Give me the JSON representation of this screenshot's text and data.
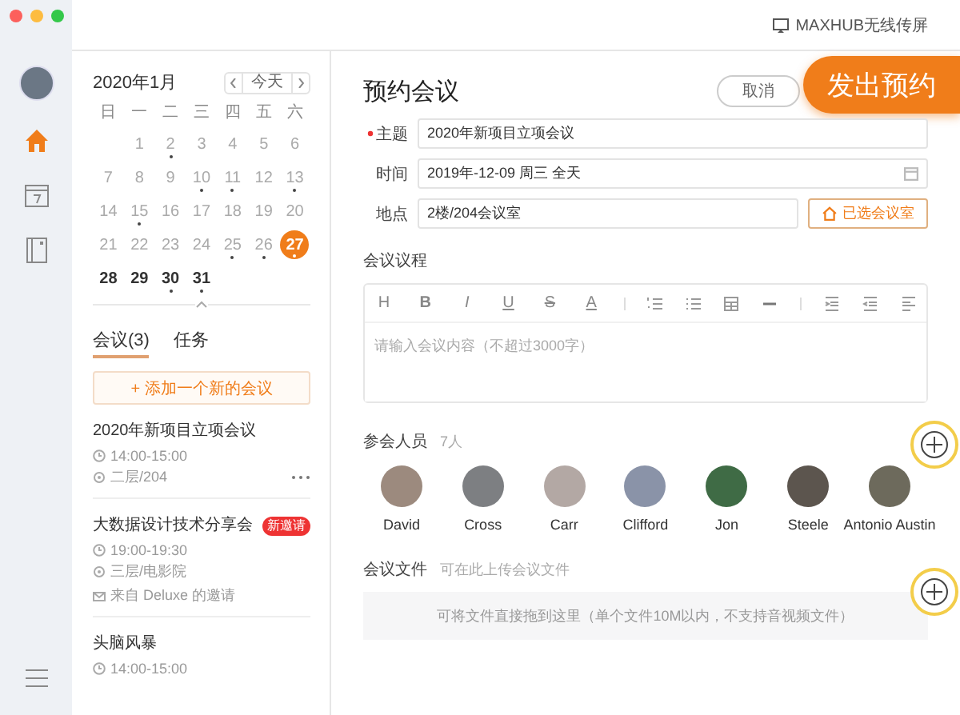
{
  "topbar": {
    "cast_label": "MAXHUB无线传屏"
  },
  "rail": {
    "items": [
      {
        "kind": "avatar",
        "selected": false
      },
      {
        "kind": "home",
        "selected": true
      },
      {
        "kind": "calendar",
        "selected": false
      },
      {
        "kind": "notebook",
        "selected": false
      },
      {
        "kind": "menu",
        "selected": false
      }
    ]
  },
  "calendar": {
    "month": "2020年1月",
    "today_button": "今天",
    "weekdays": [
      "日",
      "一",
      "二",
      "三",
      "四",
      "五",
      "六"
    ],
    "days": [
      {
        "label": "1",
        "dot": false,
        "muted": true,
        "selected": false
      },
      {
        "label": "2",
        "dot": true,
        "muted": true,
        "selected": false
      },
      {
        "label": "3",
        "dot": false,
        "muted": true,
        "selected": false
      },
      {
        "label": "4",
        "dot": false,
        "muted": true,
        "selected": false
      },
      {
        "label": "5",
        "dot": false,
        "muted": true,
        "selected": false
      },
      {
        "label": "6",
        "dot": false,
        "muted": true,
        "selected": false
      },
      {
        "label": "7",
        "dot": false,
        "muted": true,
        "selected": false
      },
      {
        "label": "8",
        "dot": false,
        "muted": true,
        "selected": false
      },
      {
        "label": "9",
        "dot": false,
        "muted": true,
        "selected": false
      },
      {
        "label": "10",
        "dot": true,
        "muted": true,
        "selected": false
      },
      {
        "label": "11",
        "dot": true,
        "muted": true,
        "selected": false
      },
      {
        "label": "12",
        "dot": false,
        "muted": true,
        "selected": false
      },
      {
        "label": "13",
        "dot": true,
        "muted": true,
        "selected": false
      },
      {
        "label": "14",
        "dot": false,
        "muted": true,
        "selected": false
      },
      {
        "label": "15",
        "dot": true,
        "muted": true,
        "selected": false
      },
      {
        "label": "16",
        "dot": false,
        "muted": true,
        "selected": false
      },
      {
        "label": "17",
        "dot": false,
        "muted": true,
        "selected": false
      },
      {
        "label": "18",
        "dot": false,
        "muted": true,
        "selected": false
      },
      {
        "label": "19",
        "dot": false,
        "muted": true,
        "selected": false
      },
      {
        "label": "20",
        "dot": false,
        "muted": true,
        "selected": false
      },
      {
        "label": "21",
        "dot": false,
        "muted": true,
        "selected": false
      },
      {
        "label": "22",
        "dot": false,
        "muted": true,
        "selected": false
      },
      {
        "label": "23",
        "dot": false,
        "muted": true,
        "selected": false
      },
      {
        "label": "24",
        "dot": false,
        "muted": true,
        "selected": false
      },
      {
        "label": "25",
        "dot": true,
        "muted": true,
        "selected": false
      },
      {
        "label": "26",
        "dot": true,
        "muted": true,
        "selected": false
      },
      {
        "label": "27",
        "dot": true,
        "muted": false,
        "selected": true
      },
      {
        "label": "28",
        "dot": false,
        "muted": false,
        "selected": false
      },
      {
        "label": "29",
        "dot": false,
        "muted": false,
        "selected": false
      },
      {
        "label": "30",
        "dot": true,
        "muted": false,
        "selected": false
      },
      {
        "label": "31",
        "dot": true,
        "muted": false,
        "selected": false
      }
    ]
  },
  "list_tabs": [
    {
      "label": "会议(3)",
      "selected": true
    },
    {
      "label": "任务",
      "selected": false
    }
  ],
  "add_meeting_button": "+ 添加一个新的会议",
  "meetings": [
    {
      "title": "2020年新项目立项会议",
      "time": "14:00-15:00",
      "location": "二层/204",
      "more": true
    },
    {
      "title": "大数据设计技术分享会",
      "badge": "新邀请",
      "time": "19:00-19:30",
      "location": "三层/电影院",
      "from": "来自 Deluxe 的邀请",
      "more": false
    },
    {
      "title": "头脑风暴",
      "time": "14:00-15:00",
      "more": false
    }
  ],
  "form": {
    "title": "预约会议",
    "cancel_button": "取消",
    "submit_button": "发出预约",
    "fields": [
      {
        "label": "主题",
        "required": true,
        "value": "2020年新项目立项会议",
        "kind": "text"
      },
      {
        "label": "时间",
        "required": false,
        "value": "2019年-12-09 周三 全天",
        "kind": "date"
      },
      {
        "label": "地点",
        "required": false,
        "value": "2楼/204会议室",
        "kind": "room",
        "action": "已选会议室"
      }
    ],
    "agenda": {
      "label": "会议议程",
      "placeholder": "请输入会议内容（不超过3000字）",
      "toolbar": [
        {
          "kind": "glyph",
          "label": "H"
        },
        {
          "kind": "bold",
          "label": "B"
        },
        {
          "kind": "italic",
          "label": "I"
        },
        {
          "kind": "underline",
          "label": "U"
        },
        {
          "kind": "strike",
          "label": "S"
        },
        {
          "kind": "color",
          "label": "A"
        },
        {
          "kind": "divider"
        },
        {
          "kind": "ordered"
        },
        {
          "kind": "bullets"
        },
        {
          "kind": "table"
        },
        {
          "kind": "rule"
        },
        {
          "kind": "divider"
        },
        {
          "kind": "indent"
        },
        {
          "kind": "outdent"
        },
        {
          "kind": "align"
        }
      ]
    },
    "participants": {
      "label": "参会人员",
      "count": "7人",
      "people": [
        "David",
        "Cross",
        "Carr",
        "Clifford",
        "Jon",
        "Steele",
        "Antonio Austin"
      ]
    },
    "files": {
      "label": "会议文件",
      "hint": "可在此上传会议文件",
      "drop_text": "可将文件直接拖到这里（单个文件10M以内，不支持音视频文件）"
    }
  }
}
